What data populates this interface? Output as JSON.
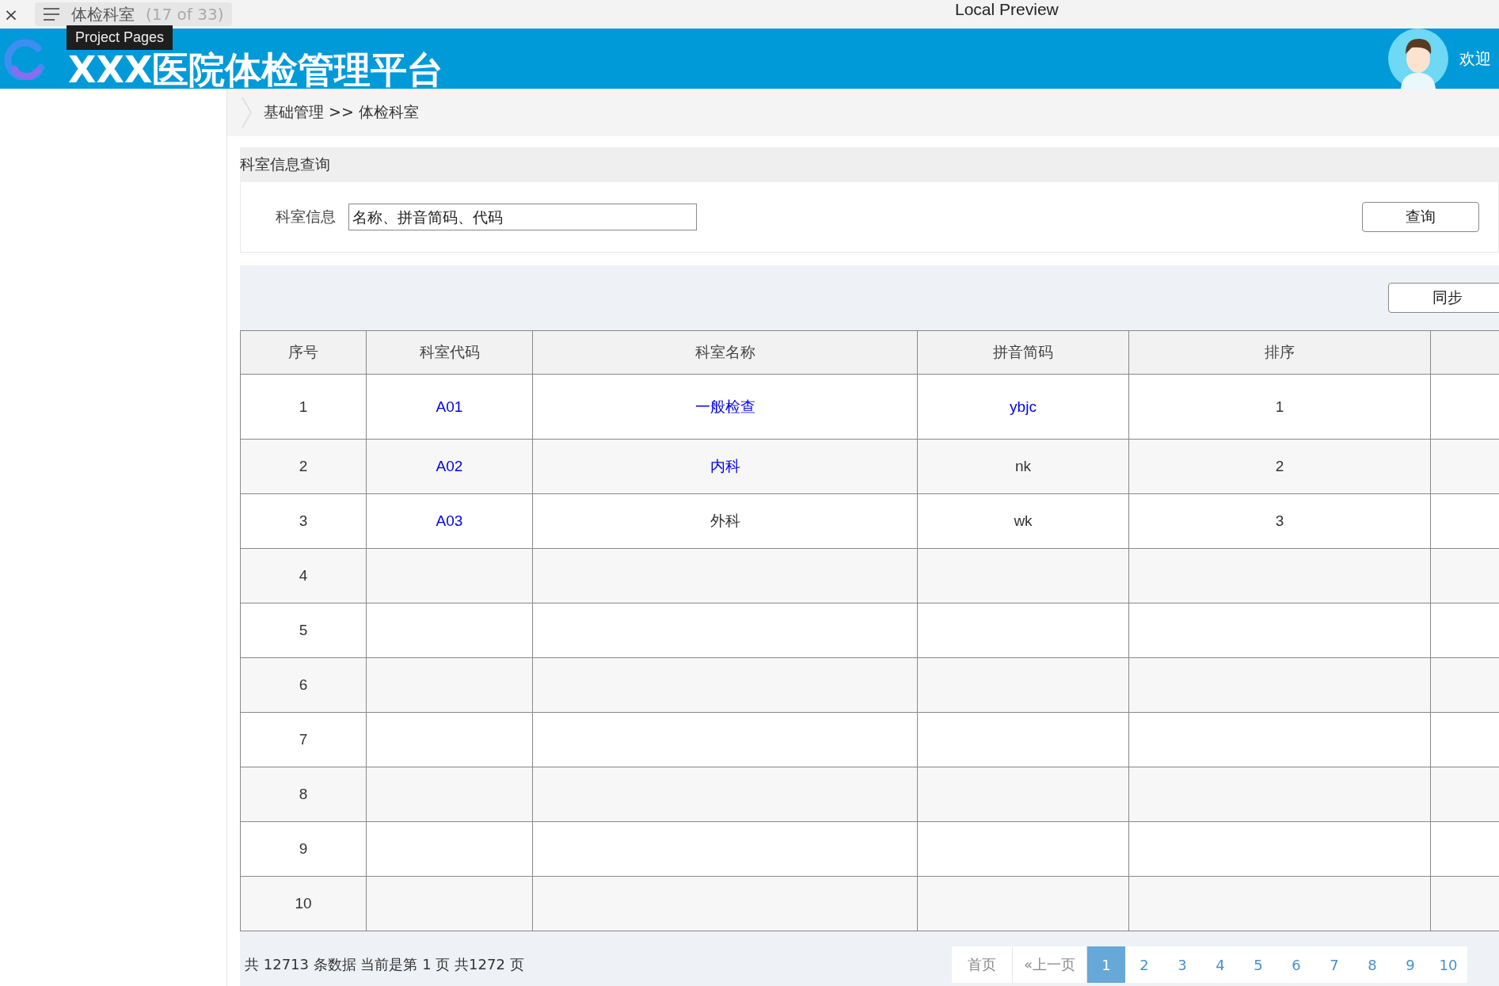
{
  "topbar": {
    "close": "×",
    "tab": {
      "title": "体检科室",
      "count": "(17 of 33)",
      "selected": true
    },
    "tooltip": "Project Pages",
    "window_title": "Local Preview"
  },
  "header": {
    "title": "XXX医院体检管理平台",
    "welcome": "欢迎"
  },
  "breadcrumb": "基础管理 >> 体检科室",
  "query": {
    "section_title": "科室信息查询",
    "label": "科室信息",
    "placeholder": "名称、拼音简码、代码",
    "button": "查询"
  },
  "toolbar": {
    "button": "同步"
  },
  "table": {
    "columns": [
      "序号",
      "科室代码",
      "科室名称",
      "拼音简码",
      "排序",
      ""
    ],
    "rows": [
      {
        "cells": [
          {
            "text": "1",
            "link": false
          },
          {
            "text": "A01",
            "link": true
          },
          {
            "text": "一般检查",
            "link": true
          },
          {
            "text": "ybjc",
            "link": true
          },
          {
            "text": "1",
            "link": false
          }
        ]
      },
      {
        "cells": [
          {
            "text": "2",
            "link": false
          },
          {
            "text": "A02",
            "link": true
          },
          {
            "text": "内科",
            "link": true
          },
          {
            "text": "nk",
            "link": false
          },
          {
            "text": "2",
            "link": false
          }
        ]
      },
      {
        "cells": [
          {
            "text": "3",
            "link": false
          },
          {
            "text": "A03",
            "link": true
          },
          {
            "text": "外科",
            "link": false
          },
          {
            "text": "wk",
            "link": false
          },
          {
            "text": "3",
            "link": false
          }
        ]
      },
      {
        "cells": [
          {
            "text": "4",
            "link": false
          }
        ]
      },
      {
        "cells": [
          {
            "text": "5",
            "link": false
          }
        ]
      },
      {
        "cells": [
          {
            "text": "6",
            "link": false
          }
        ]
      },
      {
        "cells": [
          {
            "text": "7",
            "link": false
          }
        ]
      },
      {
        "cells": [
          {
            "text": "8",
            "link": false
          }
        ]
      },
      {
        "cells": [
          {
            "text": "9",
            "link": false
          }
        ]
      },
      {
        "cells": [
          {
            "text": "10",
            "link": false
          }
        ]
      }
    ]
  },
  "pagination": {
    "summary": "共 12713 条数据 当前是第 1 页 共1272 页",
    "pages": [
      {
        "label": "首页",
        "selected": false
      },
      {
        "label": "«上一页",
        "selected": false
      },
      {
        "label": "1",
        "selected": true
      },
      {
        "label": "2",
        "selected": false
      },
      {
        "label": "3",
        "selected": false
      },
      {
        "label": "4",
        "selected": false
      },
      {
        "label": "5",
        "selected": false
      },
      {
        "label": "6",
        "selected": false
      },
      {
        "label": "7",
        "selected": false
      },
      {
        "label": "8",
        "selected": false
      },
      {
        "label": "9",
        "selected": false
      },
      {
        "label": "10",
        "selected": false
      }
    ]
  }
}
